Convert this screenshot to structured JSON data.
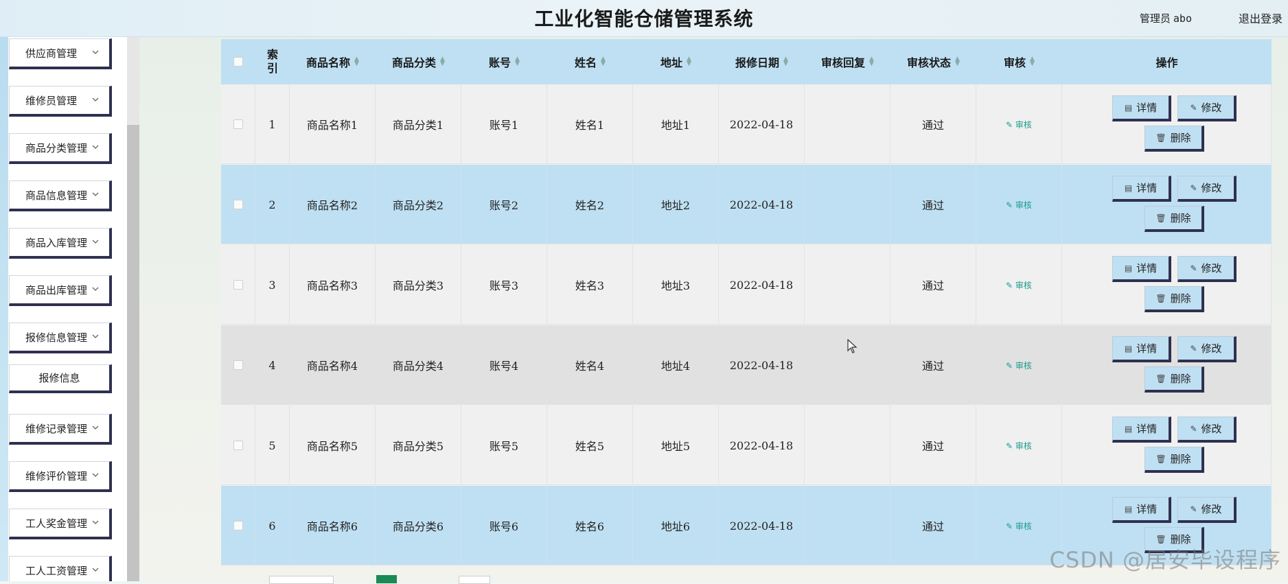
{
  "header": {
    "title": "工业化智能仓储管理系统",
    "user_label": "管理员",
    "username": "abo",
    "logout_label": "退出登录"
  },
  "sidebar": {
    "items": [
      {
        "label": "供应商管理",
        "type": "group"
      },
      {
        "label": "维修员管理",
        "type": "group"
      },
      {
        "label": "商品分类管理",
        "type": "group"
      },
      {
        "label": "商品信息管理",
        "type": "group"
      },
      {
        "label": "商品入库管理",
        "type": "group"
      },
      {
        "label": "商品出库管理",
        "type": "group"
      },
      {
        "label": "报修信息管理",
        "type": "group"
      },
      {
        "label": "报修信息",
        "type": "sub"
      },
      {
        "label": "维修记录管理",
        "type": "group"
      },
      {
        "label": "维修评价管理",
        "type": "group"
      },
      {
        "label": "工人奖金管理",
        "type": "group"
      },
      {
        "label": "工人工资管理",
        "type": "group"
      }
    ]
  },
  "table": {
    "columns": {
      "index": "索引",
      "name": "商品名称",
      "category": "商品分类",
      "account": "账号",
      "person": "姓名",
      "address": "地址",
      "date": "报修日期",
      "reply": "审核回复",
      "status": "审核状态",
      "audit": "审核",
      "ops": "操作"
    },
    "rows": [
      {
        "index": "1",
        "name": "商品名称1",
        "category": "商品分类1",
        "account": "账号1",
        "person": "姓名1",
        "address": "地址1",
        "date": "2022-04-18",
        "reply": "",
        "status": "通过",
        "audit": "审核"
      },
      {
        "index": "2",
        "name": "商品名称2",
        "category": "商品分类2",
        "account": "账号2",
        "person": "姓名2",
        "address": "地址2",
        "date": "2022-04-18",
        "reply": "",
        "status": "通过",
        "audit": "审核"
      },
      {
        "index": "3",
        "name": "商品名称3",
        "category": "商品分类3",
        "account": "账号3",
        "person": "姓名3",
        "address": "地址3",
        "date": "2022-04-18",
        "reply": "",
        "status": "通过",
        "audit": "审核"
      },
      {
        "index": "4",
        "name": "商品名称4",
        "category": "商品分类4",
        "account": "账号4",
        "person": "姓名4",
        "address": "地址4",
        "date": "2022-04-18",
        "reply": "",
        "status": "通过",
        "audit": "审核"
      },
      {
        "index": "5",
        "name": "商品名称5",
        "category": "商品分类5",
        "account": "账号5",
        "person": "姓名5",
        "address": "地址5",
        "date": "2022-04-18",
        "reply": "",
        "status": "通过",
        "audit": "审核"
      },
      {
        "index": "6",
        "name": "商品名称6",
        "category": "商品分类6",
        "account": "账号6",
        "person": "姓名6",
        "address": "地址6",
        "date": "2022-04-18",
        "reply": "",
        "status": "通过",
        "audit": "审核"
      }
    ],
    "actions": {
      "detail": "详情",
      "edit": "修改",
      "delete": "删除"
    }
  },
  "watermark": "CSDN @居安毕设程序",
  "colors": {
    "header_bg": "#dfeef6",
    "row_blue": "#bfe0f2",
    "row_gray": "#e1e1e1",
    "button_shadow": "#2f3050",
    "audit_link": "#1a9c8c",
    "pager_active": "#1a8a55"
  },
  "icons": {
    "chevron": "chevron-down-icon",
    "sort": "sort-icon",
    "detail": "document-icon",
    "edit": "pencil-icon",
    "delete": "trash-icon",
    "audit": "pencil-icon"
  }
}
